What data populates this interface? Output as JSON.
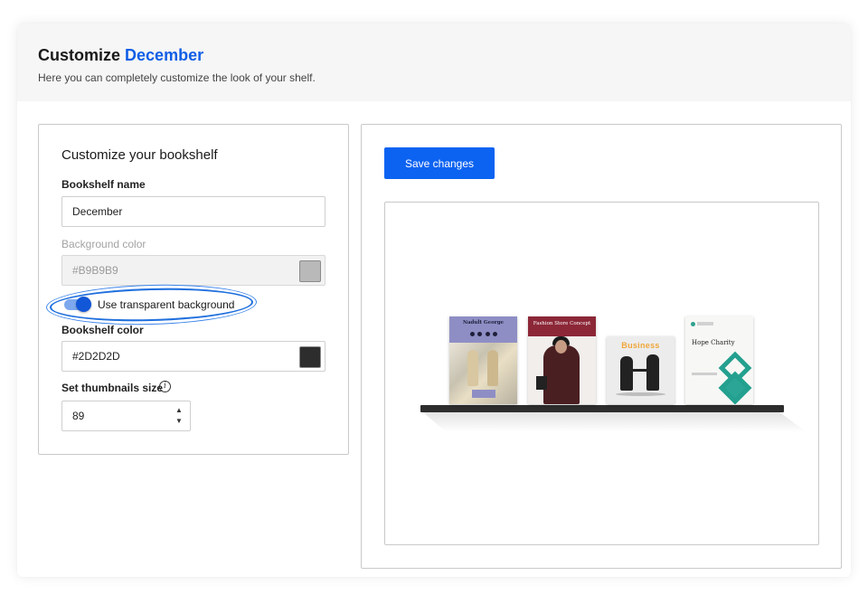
{
  "header": {
    "title_prefix": "Customize",
    "title_name": "December",
    "subtitle": "Here you can completely customize the look of your shelf."
  },
  "form": {
    "panel_title": "Customize your bookshelf",
    "bookshelf_name_label": "Bookshelf name",
    "bookshelf_name_value": "December",
    "background_color_label": "Background color",
    "background_color_value": "#B9B9B9",
    "transparent_toggle_label": "Use transparent background",
    "transparent_toggle_on": true,
    "bookshelf_color_label": "Bookshelf color",
    "bookshelf_color_value": "#2D2D2D",
    "thumbnails_label": "Set thumbnails size",
    "thumbnails_value": "89"
  },
  "actions": {
    "save_label": "Save changes"
  },
  "preview": {
    "books": [
      {
        "title": "Nadult George"
      },
      {
        "title": "Fashion Store Concept"
      },
      {
        "title": "Business"
      },
      {
        "title": "Hope Charity"
      }
    ]
  },
  "colors": {
    "accent": "#0F5EE6",
    "button": "#0C63F1",
    "background_swatch": "#B9B9B9",
    "shelf_swatch": "#2D2D2D"
  },
  "icons": [
    "info-icon",
    "stepper-arrows-icon",
    "toggle-switch"
  ]
}
